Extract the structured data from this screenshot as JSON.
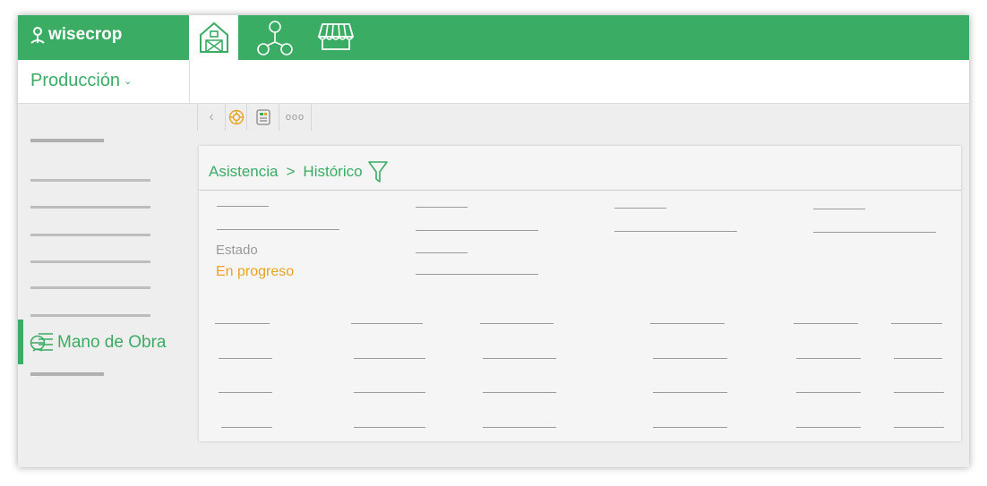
{
  "app": {
    "logo_text": "wisecrop"
  },
  "topnav": [
    {
      "name": "farm-icon",
      "active": true
    },
    {
      "name": "network-icon",
      "active": false
    },
    {
      "name": "market-stall-icon",
      "active": false
    }
  ],
  "section": {
    "label": "Producción",
    "chevron": "⌄"
  },
  "sidebar": {
    "active_item": {
      "label": "Mano de Obra",
      "icon": "workers-icon"
    }
  },
  "toolbar": {
    "back": "‹",
    "more": "ooo"
  },
  "breadcrumb": {
    "root": "Asistencia",
    "separator": ">",
    "current": "Histórico"
  },
  "details": {
    "estado_label": "Estado",
    "estado_value": "En progreso"
  },
  "colors": {
    "brand": "#3aac63",
    "status_in_progress": "#e8a320"
  }
}
